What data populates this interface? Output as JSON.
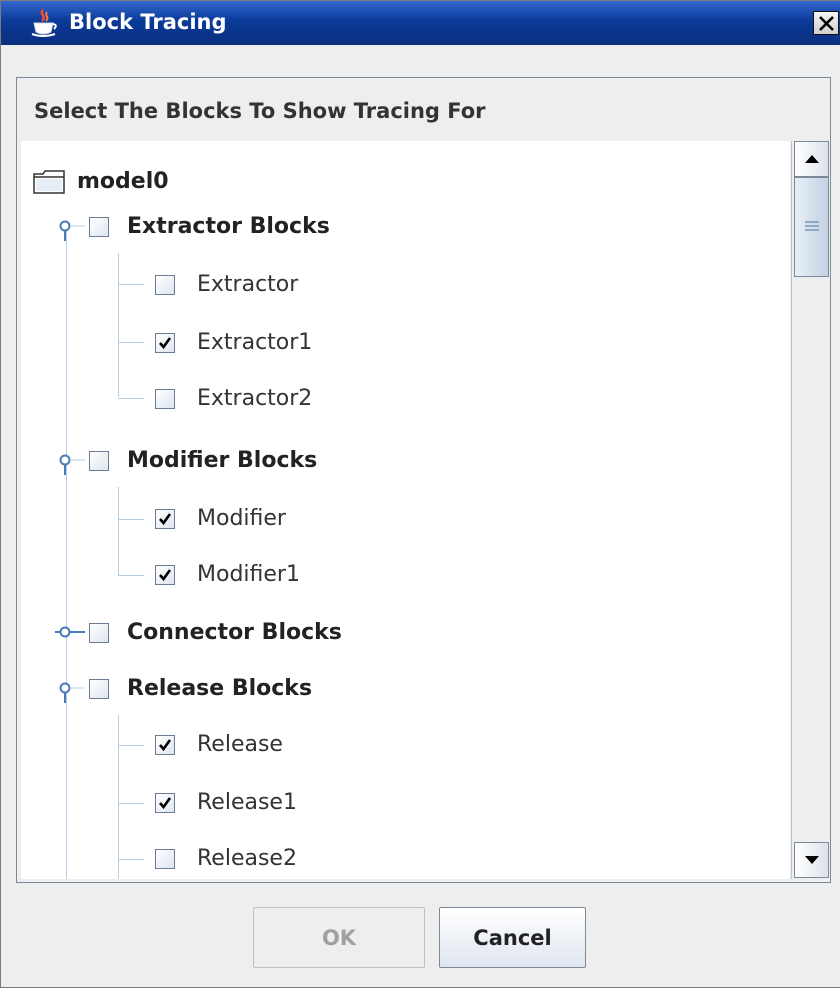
{
  "window": {
    "title": "Block Tracing",
    "close_label": "Close"
  },
  "panel": {
    "header": "Select The Blocks To Show Tracing For"
  },
  "tree": {
    "root": "model0",
    "groups": [
      {
        "label": "Extractor Blocks",
        "checked": false,
        "expanded": true,
        "children": [
          {
            "label": "Extractor",
            "checked": false
          },
          {
            "label": "Extractor1",
            "checked": true
          },
          {
            "label": "Extractor2",
            "checked": false
          }
        ]
      },
      {
        "label": "Modifier Blocks",
        "checked": false,
        "expanded": true,
        "children": [
          {
            "label": "Modifier",
            "checked": true
          },
          {
            "label": "Modifier1",
            "checked": true
          }
        ]
      },
      {
        "label": "Connector Blocks",
        "checked": false,
        "expanded": false,
        "children": []
      },
      {
        "label": "Release Blocks",
        "checked": false,
        "expanded": true,
        "children": [
          {
            "label": "Release",
            "checked": true
          },
          {
            "label": "Release1",
            "checked": true
          },
          {
            "label": "Release2",
            "checked": false
          }
        ]
      }
    ]
  },
  "buttons": {
    "ok": {
      "label": "OK",
      "enabled": false
    },
    "cancel": {
      "label": "Cancel",
      "enabled": true
    }
  },
  "colors": {
    "titlebar": "#0a3a98",
    "tree_line": "#b8cfe5",
    "window_bg": "#eeeeee"
  }
}
